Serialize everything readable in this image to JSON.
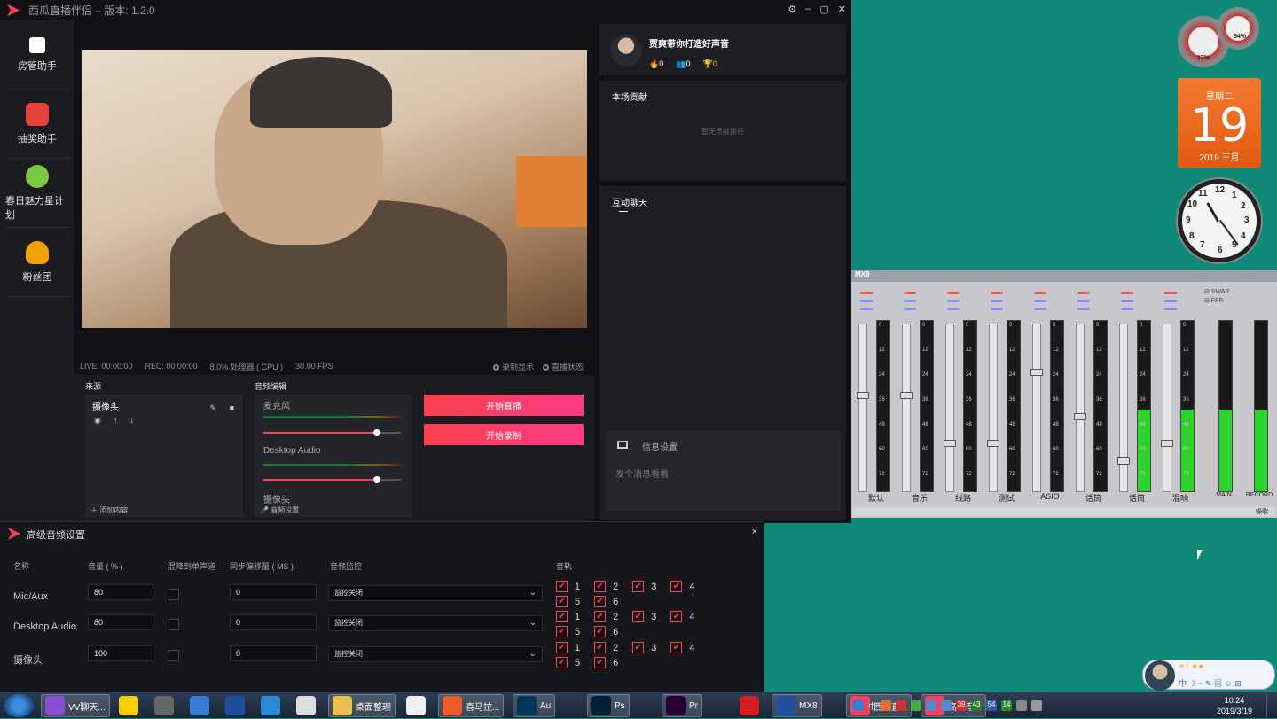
{
  "app": {
    "title": "西瓜直播伴侣 – 版本: 1.2.0",
    "controls": [
      "⚙",
      "–",
      "▢",
      "✕"
    ]
  },
  "sidebar": {
    "items": [
      {
        "label": "房管助手",
        "icon": "shield-user-icon",
        "color": "#ffffff"
      },
      {
        "label": "抽奖助手",
        "icon": "lottery-icon",
        "color": "#e8403a"
      },
      {
        "label": "春日魅力星计划",
        "icon": "star-plan-icon",
        "color": "#7ac943"
      },
      {
        "label": "粉丝团",
        "icon": "fan-club-icon",
        "color": "#f5a000"
      }
    ]
  },
  "status": {
    "live": "LIVE: 00:00:00",
    "rec": "REC: 00:00:00",
    "cpu": "8.0% 处理器 ( CPU )",
    "fps": "30.00 FPS",
    "record_display": "录制显示",
    "live_status": "直播状态"
  },
  "sources": {
    "title": "来源",
    "item": "摄像头",
    "add": "添加内容"
  },
  "audio_edit": {
    "title": "音频编辑",
    "channels": [
      {
        "name": "麦克风",
        "volume": 0.8
      },
      {
        "name": "Desktop Audio",
        "volume": 0.8
      },
      {
        "name": "摄像头",
        "volume": 1.0
      }
    ],
    "settings": "音频设置"
  },
  "buttons": {
    "start_live": "开始直播",
    "start_record": "开始录制"
  },
  "streamer": {
    "name": "贾爽带你打造好声音",
    "stat1": "0",
    "stat2": "0",
    "stat3": "0"
  },
  "contribution": {
    "title": "本场贡献",
    "empty": "暂无贡献排行"
  },
  "chat": {
    "title": "互动聊天",
    "settings": "信息设置",
    "placeholder": "发个消息看看"
  },
  "widgets": {
    "cpu_pct": "17%",
    "mem_pct": "54%",
    "weekday": "星期二",
    "day": "19",
    "year_month": "2019 三月",
    "clock_numbers": [
      "12",
      "1",
      "2",
      "3",
      "4",
      "5",
      "6",
      "7",
      "8",
      "9",
      "10",
      "11"
    ]
  },
  "mixer": {
    "title": "MX8",
    "scale": [
      "0",
      "12",
      "24",
      "36",
      "48",
      "60",
      "72"
    ],
    "channels": [
      "默认",
      "音乐",
      "线路",
      "测试",
      "ASIO",
      "话筒",
      "话筒",
      "混响"
    ],
    "extra": [
      "MAIN",
      "RECORD"
    ],
    "swap": "SWAP",
    "ffr": "FFR",
    "fader_labels": [
      "0",
      "0",
      "0.0",
      "0.0",
      "100",
      "0",
      "-10.0",
      "0.0",
      "0.0"
    ],
    "bottom_right": "噪歌"
  },
  "advanced_audio": {
    "title": "高级音频设置",
    "close": "×",
    "headers": {
      "name": "名称",
      "volume": "音量 ( % )",
      "downmix": "混降到单声道",
      "sync": "同步偏移量 ( MS )",
      "monitor": "音频监控",
      "tracks": "音轨"
    },
    "rows": [
      {
        "name": "Mic/Aux",
        "volume": "80",
        "sync": "0",
        "monitor": "监控关闭"
      },
      {
        "name": "Desktop Audio",
        "volume": "80",
        "sync": "0",
        "monitor": "监控关闭"
      },
      {
        "name": "摄像头",
        "volume": "100",
        "sync": "0",
        "monitor": "监控关闭"
      }
    ],
    "track_numbers": [
      "1",
      "2",
      "3",
      "4",
      "5",
      "6"
    ]
  },
  "taskbar": {
    "items": [
      {
        "label": "VV聊天...",
        "color": "#8a4fd0"
      },
      {
        "label": "",
        "color": "#f4d000"
      },
      {
        "label": "",
        "color": "#666"
      },
      {
        "label": "",
        "color": "#3a7bd5"
      },
      {
        "label": "",
        "color": "#1d4f9c"
      },
      {
        "label": "",
        "color": "#2a8ad8"
      },
      {
        "label": "",
        "color": "#ddd"
      },
      {
        "label": "桌面整理",
        "color": "#e8c050"
      },
      {
        "label": "",
        "color": "#eee"
      },
      {
        "label": "喜马拉...",
        "color": "#f05a28"
      },
      {
        "label": "Au",
        "color": "#00365c"
      },
      {
        "label": "Ps",
        "color": "#001e36"
      },
      {
        "label": "Pr",
        "color": "#2a0034"
      },
      {
        "label": "",
        "color": "#d02020"
      },
      {
        "label": "MX8",
        "color": "#2050a0"
      },
      {
        "label": "西瓜直...",
        "color": "#ff3e5b"
      },
      {
        "label": "高级音...",
        "color": "#ff3e5b"
      }
    ],
    "tray_input": "中",
    "tray_nums": [
      "39",
      "43",
      "54",
      "14"
    ],
    "time": "10:24",
    "date": "2019/3/19"
  },
  "ime": {
    "row": "中 ☽ ⌁ ✎ ▤ ☺ ⊞",
    "level": "☀☾★★"
  }
}
